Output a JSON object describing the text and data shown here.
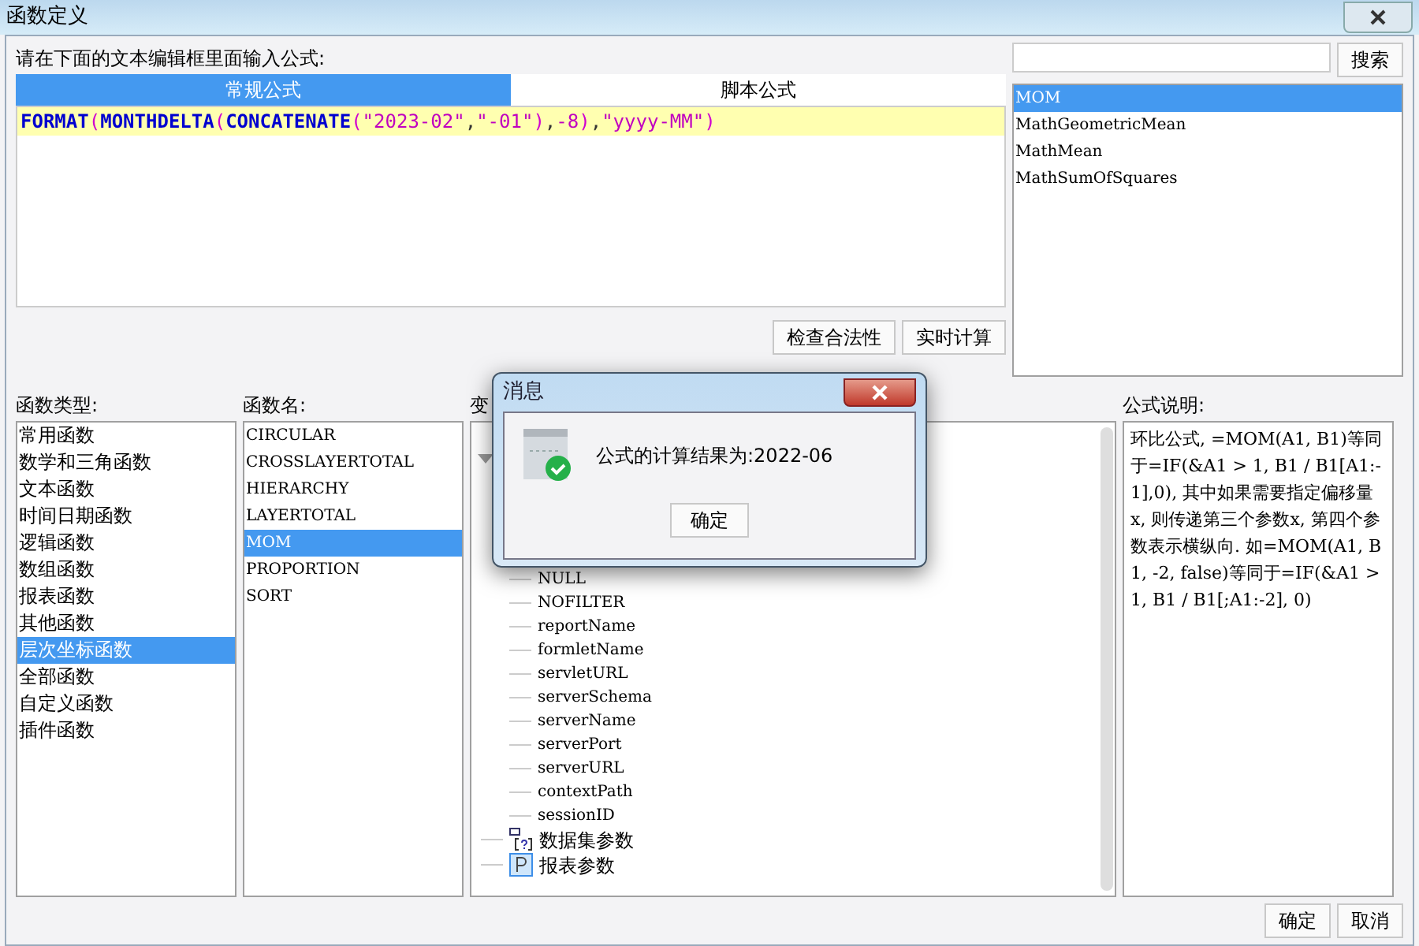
{
  "window": {
    "title": "函数定义"
  },
  "editor": {
    "prompt": "请在下面的文本编辑框里面输入公式:",
    "tabs": [
      {
        "label": "常规公式",
        "selected": true
      },
      {
        "label": "脚本公式",
        "selected": false
      }
    ],
    "formula": [
      {
        "kind": "func",
        "text": "FORMAT"
      },
      {
        "kind": "paren",
        "text": "("
      },
      {
        "kind": "func",
        "text": "MONTHDELTA"
      },
      {
        "kind": "paren",
        "text": "("
      },
      {
        "kind": "func",
        "text": "CONCATENATE"
      },
      {
        "kind": "paren",
        "text": "("
      },
      {
        "kind": "string",
        "text": "\"2023-02\""
      },
      {
        "kind": "punct",
        "text": ","
      },
      {
        "kind": "string",
        "text": "\"-01\""
      },
      {
        "kind": "paren",
        "text": ")"
      },
      {
        "kind": "punct",
        "text": ","
      },
      {
        "kind": "string",
        "text": "-8"
      },
      {
        "kind": "paren",
        "text": ")"
      },
      {
        "kind": "punct",
        "text": ","
      },
      {
        "kind": "string",
        "text": "\"yyyy-MM\""
      },
      {
        "kind": "paren",
        "text": ")"
      }
    ],
    "buttons": [
      "检查合法性",
      "实时计算"
    ]
  },
  "search": {
    "button": "搜索",
    "results": [
      {
        "label": "MOM",
        "selected": true
      },
      {
        "label": "MathGeometricMean",
        "selected": false
      },
      {
        "label": "MathMean",
        "selected": false
      },
      {
        "label": "MathSumOfSquares",
        "selected": false
      }
    ]
  },
  "categories": {
    "label": "函数类型:",
    "items": [
      {
        "label": "常用函数",
        "selected": false
      },
      {
        "label": "数学和三角函数",
        "selected": false
      },
      {
        "label": "文本函数",
        "selected": false
      },
      {
        "label": "时间日期函数",
        "selected": false
      },
      {
        "label": "逻辑函数",
        "selected": false
      },
      {
        "label": "数组函数",
        "selected": false
      },
      {
        "label": "报表函数",
        "selected": false
      },
      {
        "label": "其他函数",
        "selected": false
      },
      {
        "label": "层次坐标函数",
        "selected": true
      },
      {
        "label": "全部函数",
        "selected": false
      },
      {
        "label": "自定义函数",
        "selected": false
      },
      {
        "label": "插件函数",
        "selected": false
      }
    ]
  },
  "functions": {
    "label": "函数名:",
    "items": [
      {
        "label": "CIRCULAR",
        "selected": false
      },
      {
        "label": "CROSSLAYERTOTAL",
        "selected": false
      },
      {
        "label": "HIERARCHY",
        "selected": false
      },
      {
        "label": "LAYERTOTAL",
        "selected": false
      },
      {
        "label": "MOM",
        "selected": true
      },
      {
        "label": "PROPORTION",
        "selected": false
      },
      {
        "label": "SORT",
        "selected": false
      }
    ]
  },
  "variables": {
    "label": "变",
    "tree": [
      {
        "kind": "folder",
        "expanded": true,
        "children": [
          {
            "label": "NULL"
          },
          {
            "label": "NOFILTER"
          },
          {
            "label": "reportName"
          },
          {
            "label": "formletName"
          },
          {
            "label": "servletURL"
          },
          {
            "label": "serverSchema"
          },
          {
            "label": "serverName"
          },
          {
            "label": "serverPort"
          },
          {
            "label": "serverURL"
          },
          {
            "label": "contextPath"
          },
          {
            "label": "sessionID"
          }
        ]
      },
      {
        "kind": "dataset",
        "label": "数据集参数"
      },
      {
        "kind": "report",
        "label": "报表参数"
      }
    ]
  },
  "description": {
    "label": "公式说明:",
    "text": "环比公式, =MOM(A1, B1)等同于=IF(&A1 > 1, B1 / B1[A1:-1],0), 其中如果需要指定偏移量x, 则传递第三个参数x, 第四个参数表示横纵向. 如=MOM(A1, B1, -2, false)等同于=IF(&A1 > 1, B1 / B1[;A1:-2], 0)"
  },
  "footer": {
    "buttons": [
      "确定",
      "取消"
    ]
  },
  "dialog": {
    "title": "消息",
    "message": "公式的计算结果为:2022-06",
    "button": "确定"
  }
}
